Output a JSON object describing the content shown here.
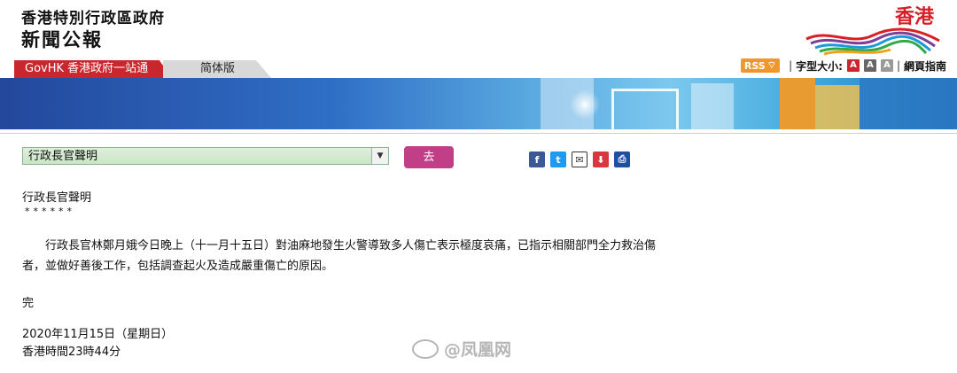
{
  "header": {
    "gov_name": "香港特別行政區政府",
    "press_title": "新聞公報",
    "logo_text": "香港",
    "logo_colors": [
      "#d91f26",
      "#7c3e97",
      "#1a9ad6",
      "#2eaa4a",
      "#f0a21c"
    ]
  },
  "tabs": {
    "govhk": "GovHK 香港政府一站通",
    "simplified": "简体版"
  },
  "utility": {
    "rss": "RSS",
    "font_size_label": "字型大小:",
    "font_small": "A",
    "font_mid": "A",
    "font_large": "A",
    "guide": "網頁指南"
  },
  "category": {
    "selected": "行政長官聲明",
    "go": "去"
  },
  "share": {
    "facebook": "f",
    "twitter": "t",
    "email": "✉",
    "save": "⬇",
    "print": "⎙"
  },
  "article": {
    "heading": "行政長官聲明",
    "stars": "******",
    "body": "行政長官林鄭月娥今日晚上（十一月十五日）對油麻地發生火警導致多人傷亡表示極度哀痛，已指示相關部門全力救治傷者，並做好善後工作，包括調查起火及造成嚴重傷亡的原因。",
    "end": "完",
    "date": "2020年11月15日（星期日）",
    "time": "香港時間23時44分"
  },
  "watermark": "@凤凰网",
  "colors": {
    "accent_red": "#c9272d",
    "go_button": "#c13f87",
    "select_green": "#c9e5c5"
  }
}
